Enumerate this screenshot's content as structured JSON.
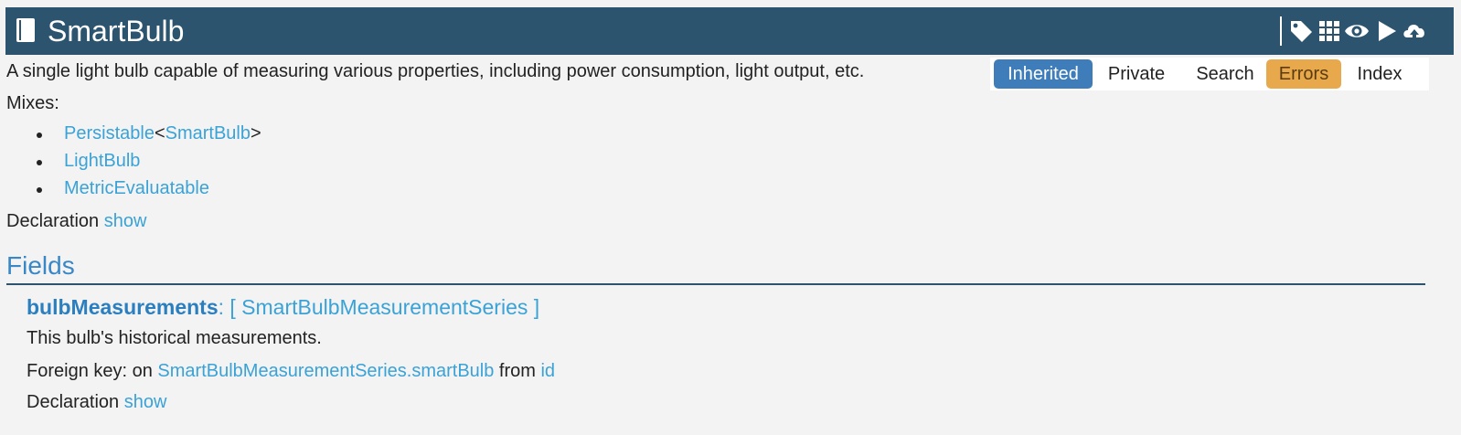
{
  "header": {
    "title": "SmartBulb",
    "icons": [
      "book-icon",
      "tag-icon",
      "grid-icon",
      "eye-icon",
      "play-icon",
      "cloud-upload-icon"
    ]
  },
  "description": "A single light bulb capable of measuring various properties, including power consumption, light output, etc.",
  "nav": {
    "inherited": "Inherited",
    "private": "Private",
    "search": "Search",
    "errors": "Errors",
    "index": "Index"
  },
  "mixes": {
    "label": "Mixes:",
    "persistable": "Persistable",
    "lt": "<",
    "persistable_arg": "SmartBulb",
    "gt": ">",
    "lightbulb": "LightBulb",
    "metric": "MetricEvaluatable"
  },
  "declaration": {
    "label": "Declaration",
    "link": "show"
  },
  "fields": {
    "heading": "Fields",
    "items": [
      {
        "name": "bulbMeasurements",
        "type_text": ": [ SmartBulbMeasurementSeries ]",
        "description": "This bulb's historical measurements.",
        "fk_prefix": "Foreign key: on",
        "fk_target": "SmartBulbMeasurementSeries.smartBulb",
        "fk_from": "from",
        "fk_key": "id",
        "decl_label": "Declaration",
        "decl_link": "show"
      }
    ]
  },
  "colors": {
    "titlebar": "#2c546f",
    "link": "#3aa2d6",
    "inherited_active": "#3e7db9",
    "errors_warning": "#e8a94d"
  }
}
